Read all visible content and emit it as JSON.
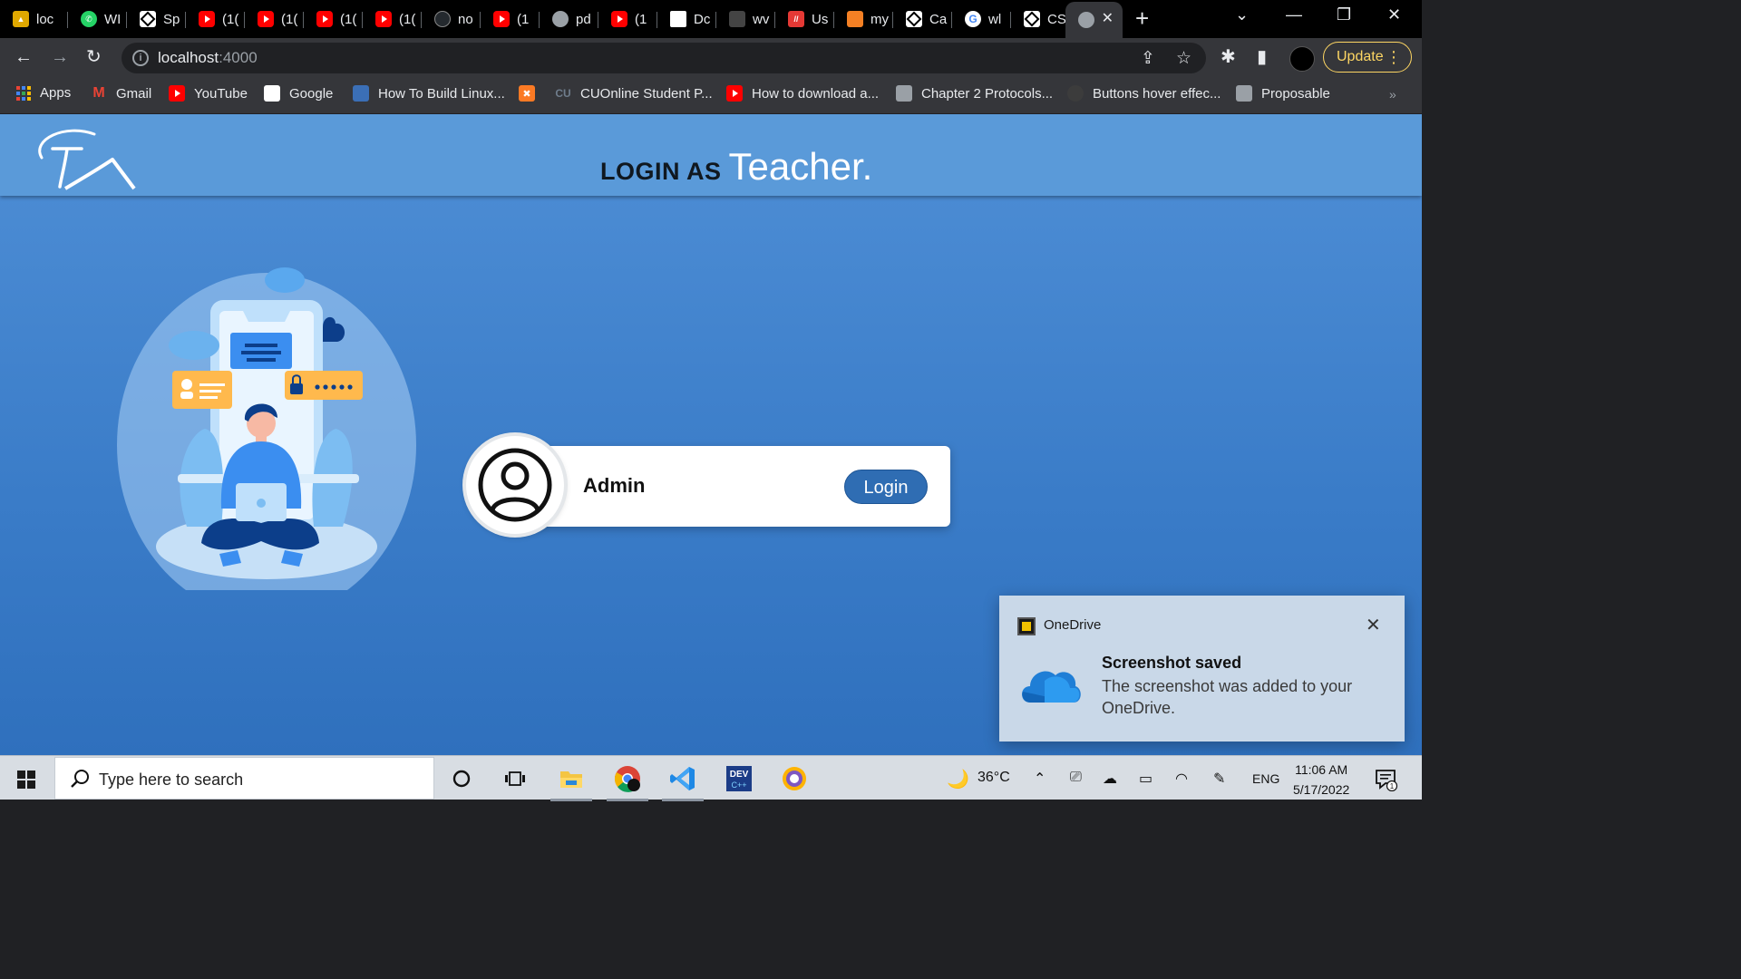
{
  "browser": {
    "tabs": [
      {
        "title": "loc",
        "icon": "brand-icon"
      },
      {
        "title": "WI",
        "icon": "whatsapp-icon"
      },
      {
        "title": "Sp",
        "icon": "codepen-icon"
      },
      {
        "title": "(1(",
        "icon": "youtube-icon"
      },
      {
        "title": "(1(",
        "icon": "youtube-icon"
      },
      {
        "title": "(1(",
        "icon": "youtube-icon"
      },
      {
        "title": "(1(",
        "icon": "youtube-icon"
      },
      {
        "title": "no",
        "icon": "github-icon"
      },
      {
        "title": "(1",
        "icon": "youtube-icon"
      },
      {
        "title": "pd",
        "icon": "globe-icon"
      },
      {
        "title": "(1",
        "icon": "youtube-icon"
      },
      {
        "title": "Dc",
        "icon": "document-icon"
      },
      {
        "title": "wv",
        "icon": "site-icon"
      },
      {
        "title": "Us",
        "icon": "red-site-icon"
      },
      {
        "title": "my",
        "icon": "stackoverflow-icon"
      },
      {
        "title": "Ca",
        "icon": "codepen-icon"
      },
      {
        "title": "wl",
        "icon": "google-icon"
      },
      {
        "title": "CS",
        "icon": "codepen-icon"
      },
      {
        "title": "",
        "icon": "globe-icon",
        "active": true
      }
    ],
    "url_host": "localhost",
    "url_port": ":4000",
    "update_label": "Update",
    "bookmarks": [
      {
        "label": "Apps",
        "icon": "apps-grid-icon"
      },
      {
        "label": "Gmail",
        "icon": "gmail-icon"
      },
      {
        "label": "YouTube",
        "icon": "youtube-icon"
      },
      {
        "label": "Google",
        "icon": "google-icon"
      },
      {
        "label": "How To Build Linux...",
        "icon": "globe-icon"
      },
      {
        "label": "",
        "icon": "xampp-icon"
      },
      {
        "label": "CUOnline Student P...",
        "icon": "cu-icon"
      },
      {
        "label": "How to download a...",
        "icon": "youtube-icon"
      },
      {
        "label": "Chapter 2 Protocols...",
        "icon": "globe-icon"
      },
      {
        "label": "Buttons hover effec...",
        "icon": "site-icon"
      },
      {
        "label": "Proposable",
        "icon": "globe-icon"
      }
    ]
  },
  "page": {
    "logo_text": "TA",
    "title_prefix": "LOGIN AS",
    "title_role": "Teacher.",
    "card": {
      "role_label": "Admin",
      "button_label": "Login"
    }
  },
  "toast": {
    "app_name": "OneDrive",
    "title": "Screenshot saved",
    "body": "The screenshot was added to your OneDrive."
  },
  "taskbar": {
    "search_placeholder": "Type here to search",
    "weather": "36°C",
    "language": "ENG",
    "time": "11:06 AM",
    "date": "5/17/2022",
    "notification_count": "1"
  },
  "colors": {
    "page_bg": "#3a7cc8",
    "header_bg": "#5a9ad9",
    "login_button": "#2f6db3",
    "update_accent": "#fdd663"
  }
}
